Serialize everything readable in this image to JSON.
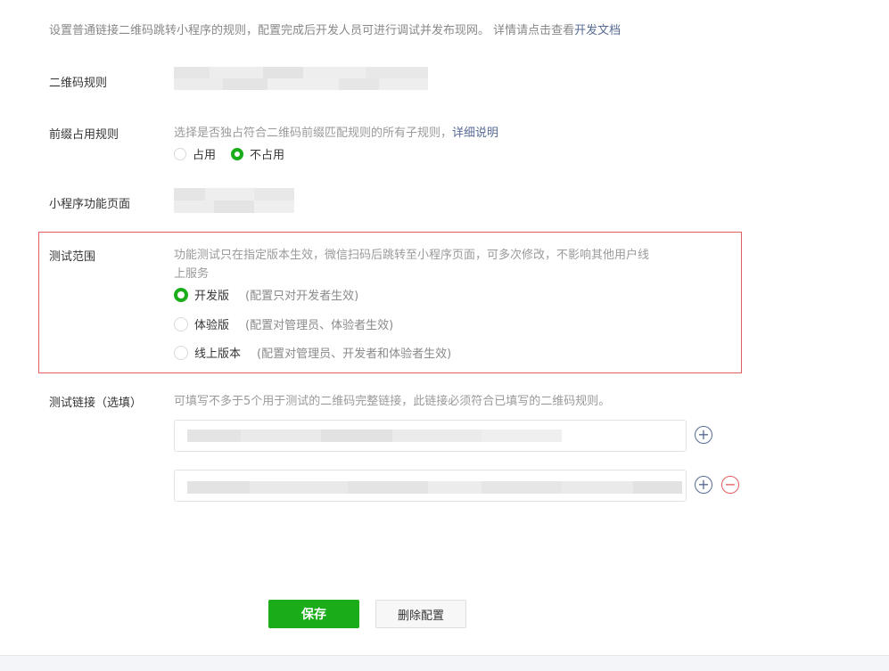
{
  "intro": {
    "text": "设置普通链接二维码跳转小程序的规则，配置完成后开发人员可进行调试并发布现网。 详情请点击查看",
    "link": "开发文档"
  },
  "qr_rule": {
    "label": "二维码规则"
  },
  "prefix": {
    "label": "前缀占用规则",
    "hint": "选择是否独占符合二维码前缀匹配规则的所有子规则，",
    "hint_link": "详细说明",
    "options": [
      {
        "label": "占用",
        "checked": false
      },
      {
        "label": "不占用",
        "checked": true
      }
    ]
  },
  "page": {
    "label": "小程序功能页面"
  },
  "scope": {
    "label": "测试范围",
    "hint_line1": "功能测试只在指定版本生效，微信扫码后跳转至小程序页面，可多次修改，不影响其他用户线",
    "hint_line2": "上服务",
    "options": [
      {
        "label": "开发版",
        "note": "(配置只对开发者生效)",
        "checked": true
      },
      {
        "label": "体验版",
        "note": "(配置对管理员、体验者生效)",
        "checked": false
      },
      {
        "label": "线上版本",
        "note": "(配置对管理员、开发者和体验者生效)",
        "checked": false
      }
    ]
  },
  "test_links": {
    "label": "测试链接（选填）",
    "hint": "可填写不多于5个用于测试的二维码完整链接，此链接必须符合已填写的二维码规则。",
    "add_icon": "plus-circle-icon",
    "remove_icon": "minus-circle-icon"
  },
  "actions": {
    "save": "保存",
    "delete": "删除配置"
  },
  "colors": {
    "accent": "#1aad19",
    "link": "#576b95",
    "danger": "#e15f5f"
  }
}
